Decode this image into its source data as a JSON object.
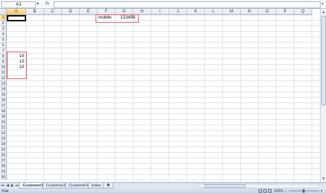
{
  "formula_bar": {
    "name_box": "A1",
    "fx_label": "fx",
    "formula": ""
  },
  "columns": [
    "A",
    "B",
    "C",
    "D",
    "E",
    "F",
    "G",
    "H",
    "I",
    "J",
    "K",
    "L",
    "M",
    "N",
    "O",
    "P",
    "Q"
  ],
  "rows": [
    "1",
    "2",
    "3",
    "4",
    "5",
    "6",
    "7",
    "8",
    "9",
    "10",
    "11",
    "12",
    "13",
    "14",
    "15",
    "16",
    "17",
    "18",
    "19",
    "20",
    "21",
    "22",
    "23",
    "24",
    "25",
    "26",
    "27",
    "28",
    "29",
    "30"
  ],
  "active_cell": "A1",
  "cells": {
    "F2": "mobile",
    "G2": "123456",
    "A8": "10",
    "A9": "10",
    "A10": "10"
  },
  "sheet_tabs": [
    {
      "label": "Customer1",
      "active": true
    },
    {
      "label": "Customer2",
      "active": false
    },
    {
      "label": "Customer3",
      "active": false
    },
    {
      "label": "index",
      "active": false
    }
  ],
  "status": {
    "text": "Klar",
    "zoom": "100%"
  },
  "colors": {
    "annotation_border": "#e05a5a",
    "active_header": "#f9c863"
  }
}
